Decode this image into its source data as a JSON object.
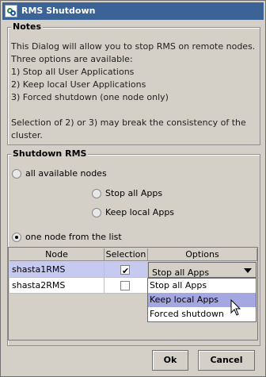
{
  "window": {
    "title": "RMS Shutdown"
  },
  "notes": {
    "legend": "Notes",
    "lines": [
      "This Dialog will allow you to stop RMS on remote nodes.",
      "Three options are available:",
      "1) Stop all User Applications",
      "2) Keep local User Applications",
      "3) Forced shutdown (one node only)",
      "",
      "Selection of 2) or 3) may break the consistency of the",
      "cluster."
    ]
  },
  "shutdown": {
    "legend": "Shutdown RMS",
    "all_nodes_label": "all available nodes",
    "stop_all_label": "Stop all Apps",
    "keep_local_label": "Keep local Apps",
    "one_node_label": "one node from the list",
    "table": {
      "headers": [
        "Node",
        "Selection",
        "Options"
      ],
      "rows": [
        {
          "node": "shasta1RMS",
          "selected": true,
          "option": "Stop all Apps"
        },
        {
          "node": "shasta2RMS",
          "selected": false,
          "option": ""
        }
      ]
    },
    "dropdown_options": [
      "Stop all Apps",
      "Keep local Apps",
      "Forced shutdown"
    ],
    "dropdown_highlighted": "Keep local Apps"
  },
  "buttons": {
    "ok": "Ok",
    "cancel": "Cancel"
  }
}
